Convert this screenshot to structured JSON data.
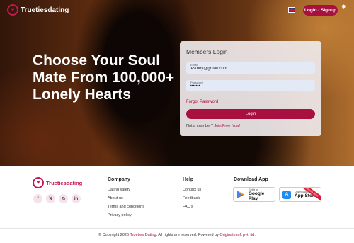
{
  "header": {
    "logo_text": "Truetiesdating",
    "login_button": "Login / Signup",
    "language_icon": "uk-flag-icon"
  },
  "hero": {
    "headline": "Choose Your Soul Mate From 100,000+ Lonely Hearts"
  },
  "login_panel": {
    "title": "Members Login",
    "email_label": "Email",
    "email_value": "testboy@gmail.com",
    "password_label": "Password",
    "password_value": "•••••••",
    "forgot_password": "Forgot Password",
    "submit_label": "Login",
    "member_prompt": "Not a member?",
    "join_link": "Join Free Now!"
  },
  "footer": {
    "logo_text": "Truetiesdating",
    "socials": [
      "f",
      "𝕏",
      "◎",
      "in"
    ],
    "company": {
      "title": "Company",
      "links": [
        "Dating safety",
        "About us",
        "Terms and conditions",
        "Privacy policy"
      ]
    },
    "help": {
      "title": "Help",
      "links": [
        "Contact us",
        "Feedback",
        "FAQ's"
      ]
    },
    "download": {
      "title": "Download App",
      "google_small": "Get it on",
      "google_big": "Google Play",
      "apple_small": "Download on the",
      "apple_big": "App Store",
      "apple_ribbon": "Coming Soon"
    },
    "copyright_prefix": "© Copyright 2026",
    "copyright_brand": "Trueties Dating",
    "copyright_middle": ". All rights are reserved. Powered by",
    "copyright_company": "Originatesoft pvt. ltd."
  },
  "colors": {
    "brand": "#a8103f",
    "accent": "#c4174e"
  }
}
